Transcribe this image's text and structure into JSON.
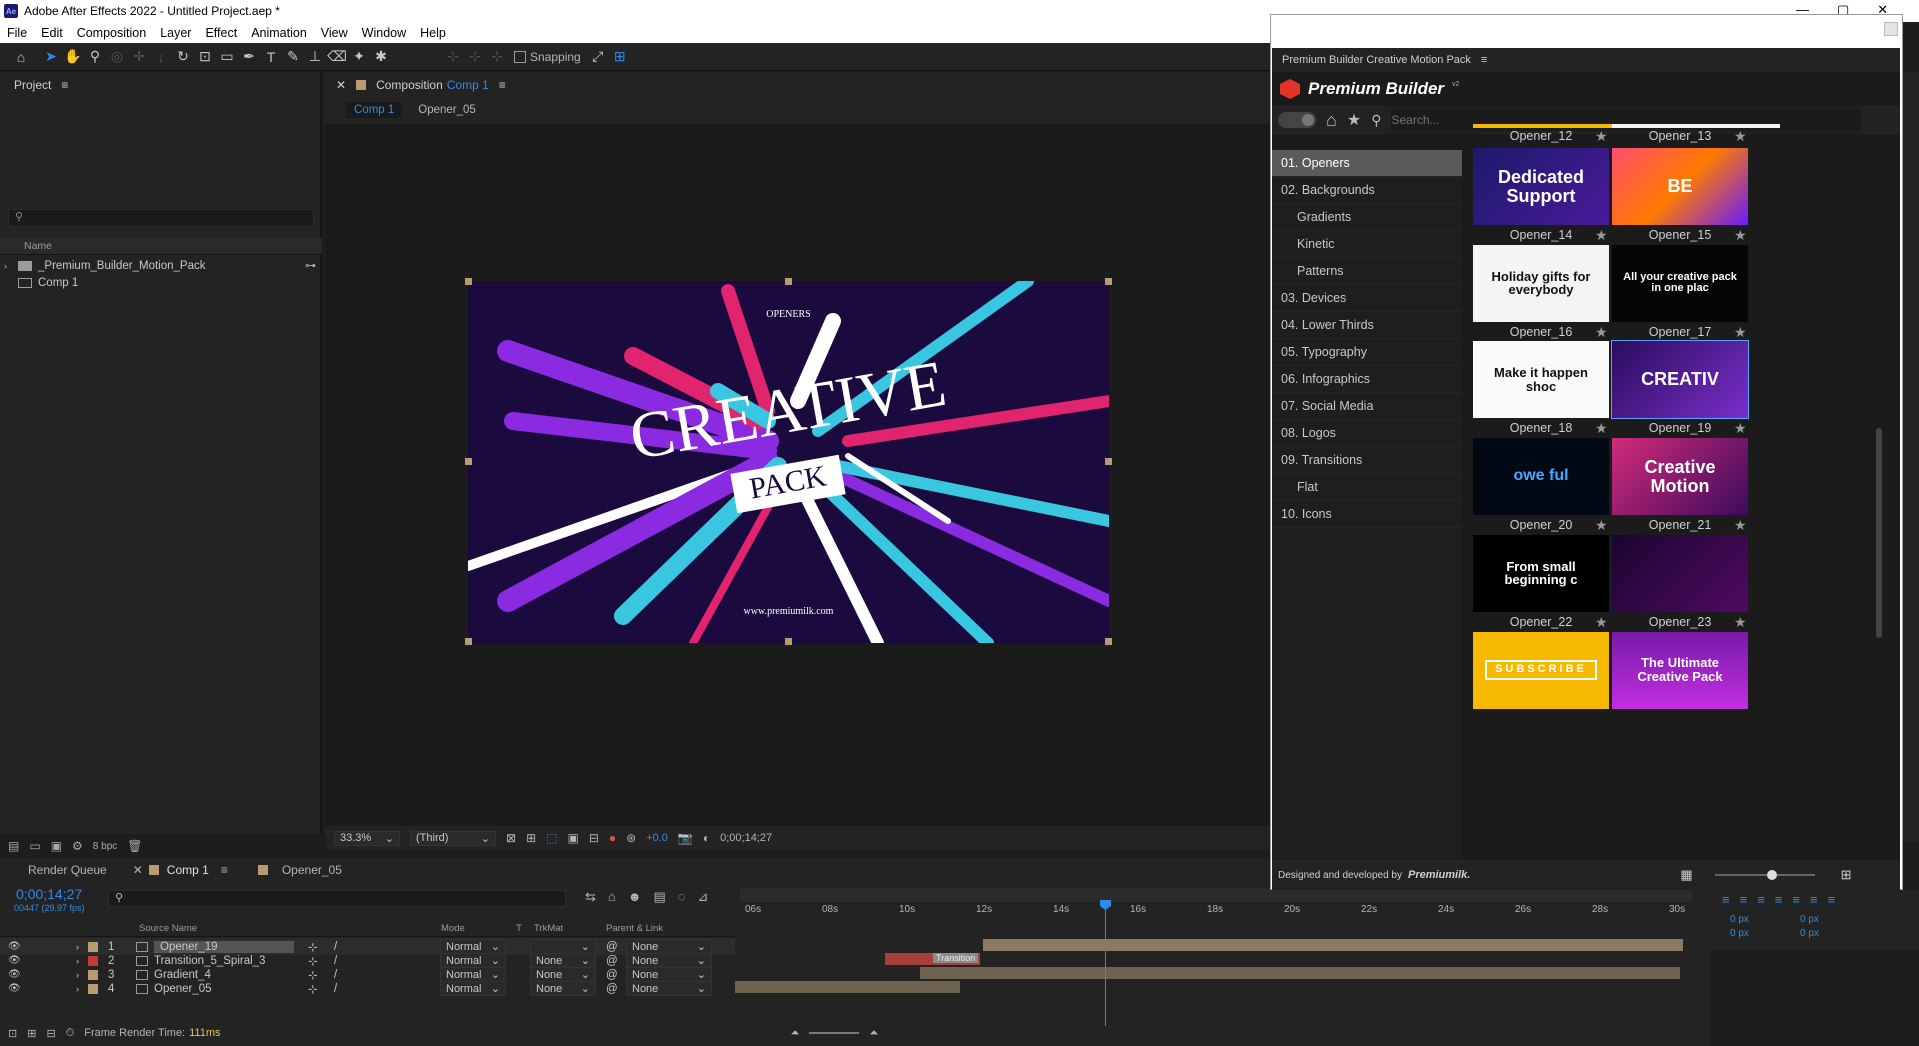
{
  "app": {
    "title": "Adobe After Effects 2022 - Untitled Project.aep *",
    "logo": "Ae"
  },
  "menu": [
    "File",
    "Edit",
    "Composition",
    "Layer",
    "Effect",
    "Animation",
    "View",
    "Window",
    "Help"
  ],
  "toolbar": {
    "snapping_label": "Snapping"
  },
  "project": {
    "panel_title": "Project",
    "col_name": "Name",
    "items": [
      "_Premium_Builder_Motion_Pack",
      "Comp 1"
    ],
    "bpc": "8 bpc"
  },
  "composition": {
    "panel_title": "Composition",
    "comp_name": "Comp 1",
    "crumbs": [
      "Comp 1",
      "Opener_05"
    ],
    "canvas": {
      "top_label": "OPENERS",
      "word1": "CREATIVE",
      "word2": "PACK",
      "url": "www.premiumilk.com"
    },
    "zoom": "33.3%",
    "resolution": "(Third)",
    "exposure": "+0.0",
    "timecode": "0;00;14;27"
  },
  "timeline": {
    "tabs": [
      "Render Queue",
      "Comp 1",
      "Opener_05"
    ],
    "timecode": "0;00;14;27",
    "frame_info": "00447 (29.97 fps)",
    "columns": [
      "Source Name",
      "Mode",
      "T",
      "TrkMat",
      "Parent & Link"
    ],
    "ruler": [
      "06s",
      "08s",
      "10s",
      "12s",
      "14s",
      "16s",
      "18s",
      "20s",
      "22s",
      "24s",
      "26s",
      "28s",
      "30s"
    ],
    "layers": [
      {
        "num": "1",
        "name": "Opener_19",
        "mode": "Normal",
        "trkmat": "",
        "parent": "None",
        "color": "#b89a74"
      },
      {
        "num": "2",
        "name": "Transition_5_Spiral_3",
        "mode": "Normal",
        "trkmat": "None",
        "parent": "None",
        "color": "#c23b3b"
      },
      {
        "num": "3",
        "name": "Gradient_4",
        "mode": "Normal",
        "trkmat": "None",
        "parent": "None",
        "color": "#b89a74"
      },
      {
        "num": "4",
        "name": "Opener_05",
        "mode": "Normal",
        "trkmat": "None",
        "parent": "None",
        "color": "#b89a74"
      }
    ],
    "clip_label": "Transition",
    "render_time_label": "Frame Render Time:",
    "render_time": "111ms",
    "align_values": [
      "0 px",
      "0 px",
      "0 px",
      "0 px"
    ]
  },
  "plugin": {
    "panel_title": "Premium Builder Creative Motion Pack",
    "brand": "Premium Builder",
    "version": "v2",
    "search_placeholder": "Search...",
    "categories": [
      {
        "label": "01. Openers",
        "sub": false,
        "selected": true
      },
      {
        "label": "02. Backgrounds",
        "sub": false,
        "selected": false
      },
      {
        "label": "Gradients",
        "sub": true,
        "selected": false
      },
      {
        "label": "Kinetic",
        "sub": true,
        "selected": false
      },
      {
        "label": "Patterns",
        "sub": true,
        "selected": false
      },
      {
        "label": "03. Devices",
        "sub": false,
        "selected": false
      },
      {
        "label": "04. Lower Thirds",
        "sub": false,
        "selected": false
      },
      {
        "label": "05. Typography",
        "sub": false,
        "selected": false
      },
      {
        "label": "06. Infographics",
        "sub": false,
        "selected": false
      },
      {
        "label": "07. Social Media",
        "sub": false,
        "selected": false
      },
      {
        "label": "08. Logos",
        "sub": false,
        "selected": false
      },
      {
        "label": "09. Transitions",
        "sub": false,
        "selected": false
      },
      {
        "label": "Flat",
        "sub": true,
        "selected": false
      },
      {
        "label": "10. Icons",
        "sub": false,
        "selected": false
      }
    ],
    "top_labels": [
      "Opener_12",
      "Opener_13"
    ],
    "items": [
      {
        "label": "Opener_14",
        "text": "Dedicated Support"
      },
      {
        "label": "Opener_15",
        "text": "BE"
      },
      {
        "label": "Opener_16",
        "text": "Holiday gifts for everybody"
      },
      {
        "label": "Opener_17",
        "text": "All your creative pack in one plac"
      },
      {
        "label": "Opener_18",
        "text": "Make it happen shoc"
      },
      {
        "label": "Opener_19",
        "text": "CREATIV"
      },
      {
        "label": "Opener_20",
        "text": "owe ful"
      },
      {
        "label": "Opener_21",
        "text": "Creative Motion"
      },
      {
        "label": "Opener_22",
        "text": "From small beginning c"
      },
      {
        "label": "Opener_23",
        "text": ""
      },
      {
        "label": "",
        "text": "SUBSCRIBE"
      },
      {
        "label": "",
        "text": "The Ultimate Creative Pack"
      }
    ],
    "footer": "Designed and developed by",
    "footer_brand": "Premiumilk."
  }
}
